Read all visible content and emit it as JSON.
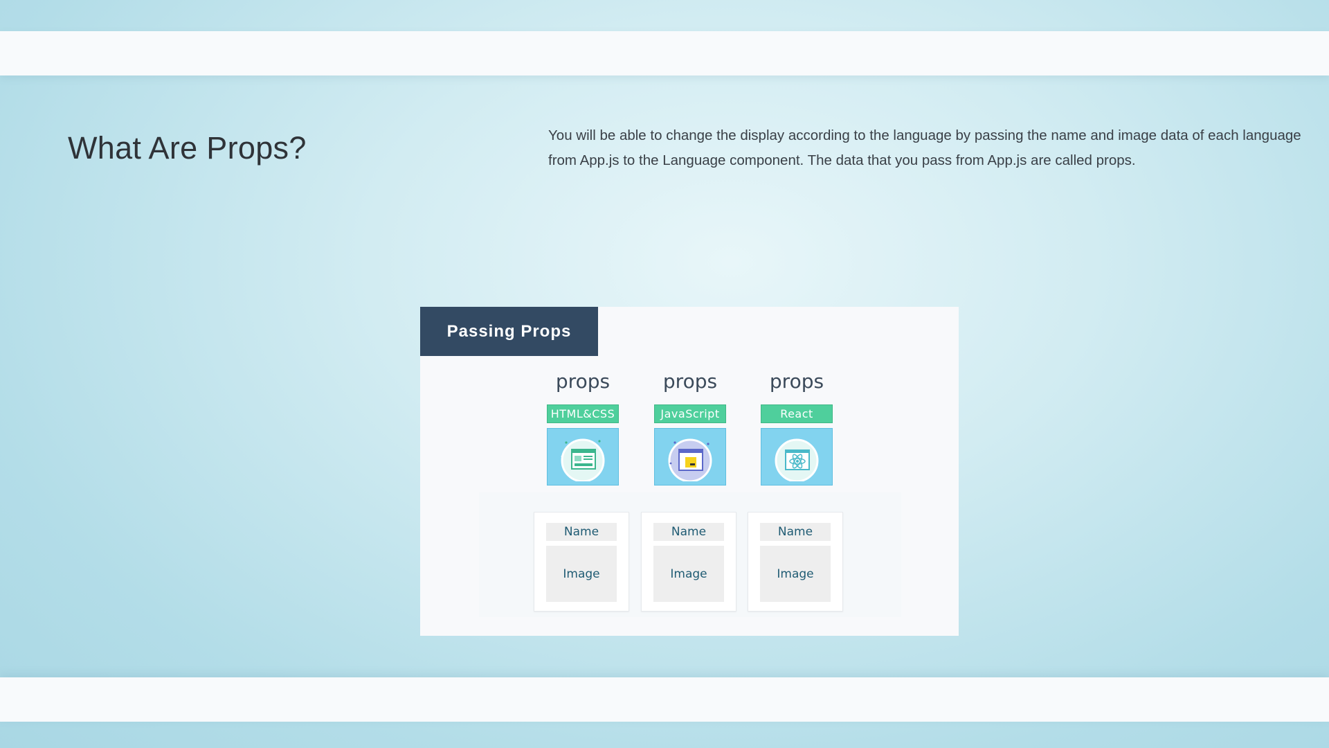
{
  "section": {
    "title": "What Are Props?",
    "description": "You will be able to change the display according to the language by passing the name and image data of each language from App.js to the Language component. The data that you pass from App.js are called props."
  },
  "diagram": {
    "tab_label": "Passing Props",
    "columns": [
      {
        "props_label": "props",
        "badge": "HTML&CSS",
        "icon": "html-css-icon",
        "card_name": "Name",
        "card_image": "Image"
      },
      {
        "props_label": "props",
        "badge": "JavaScript",
        "icon": "javascript-icon",
        "card_name": "Name",
        "card_image": "Image"
      },
      {
        "props_label": "props",
        "badge": "React",
        "icon": "react-icon",
        "card_name": "Name",
        "card_image": "Image"
      }
    ]
  },
  "colors": {
    "tab_bg": "#334a63",
    "badge_bg": "#4fcf9c",
    "tile_bg": "#82d3ef",
    "card_text": "#1f5b73"
  }
}
